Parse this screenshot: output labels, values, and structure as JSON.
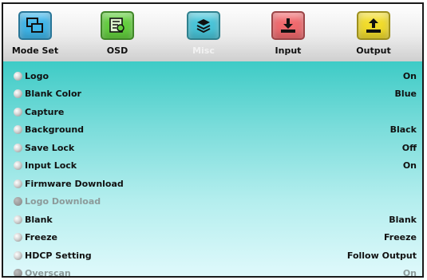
{
  "tabs": [
    {
      "label": "Mode Set",
      "icon": "windows-icon",
      "color": "#3fb6ea",
      "active": false
    },
    {
      "label": "OSD",
      "icon": "osd-list-icon",
      "color": "#63cf3e",
      "active": false
    },
    {
      "label": "Misc",
      "icon": "stack-icon",
      "color": "#49c5d9",
      "active": true
    },
    {
      "label": "Input",
      "icon": "input-arrow-icon",
      "color": "#f06a6e",
      "active": false
    },
    {
      "label": "Output",
      "icon": "output-arrow-icon",
      "color": "#f1dc2c",
      "active": false
    }
  ],
  "menu": {
    "items": [
      {
        "label": "Logo",
        "value": "On",
        "enabled": true
      },
      {
        "label": "Blank Color",
        "value": "Blue",
        "enabled": true
      },
      {
        "label": "Capture",
        "value": "",
        "enabled": true
      },
      {
        "label": "Background",
        "value": "Black",
        "enabled": true
      },
      {
        "label": "Save Lock",
        "value": "Off",
        "enabled": true
      },
      {
        "label": "Input Lock",
        "value": "On",
        "enabled": true
      },
      {
        "label": "Firmware Download",
        "value": "",
        "enabled": true
      },
      {
        "label": "Logo Download",
        "value": "",
        "enabled": false
      },
      {
        "label": "Blank",
        "value": "Blank",
        "enabled": true
      },
      {
        "label": "Freeze",
        "value": "Freeze",
        "enabled": true
      },
      {
        "label": "HDCP Setting",
        "value": "Follow Output",
        "enabled": true
      },
      {
        "label": "Overscan",
        "value": "On",
        "enabled": false
      }
    ]
  }
}
